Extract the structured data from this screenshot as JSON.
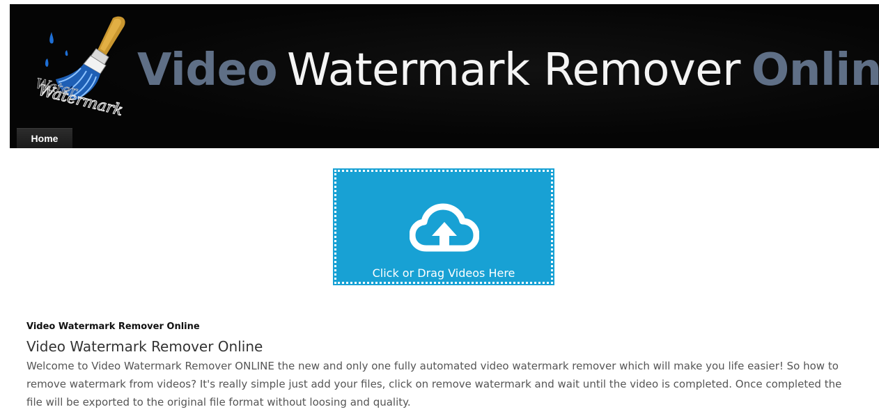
{
  "header": {
    "logo": {
      "name": "paintbrush-watermark-logo",
      "text": "Watermark"
    },
    "title": {
      "part1": "Video",
      "part2": "Watermark Remover",
      "part3": "Online"
    },
    "colors": {
      "background": "#050505",
      "accent": "#5f6f86",
      "title_light": "#f4f4f4"
    }
  },
  "nav": {
    "items": [
      {
        "label": "Home",
        "active": true
      }
    ]
  },
  "upload": {
    "icon": "cloud-upload-icon",
    "label": "Click or Drag Videos Here",
    "color": "#18a1d4"
  },
  "content": {
    "small_heading": "Video Watermark Remover Online",
    "heading": "Video Watermark Remover Online",
    "paragraph": "Welcome to Video Watermark Remover ONLINE the new and only one fully automated video watermark remover which will make you life easier! So how to remove watermark from videos? It's really simple just add your files, click on remove watermark and wait until the video is completed. Once completed the file will be exported to the original file format without loosing and quality."
  }
}
